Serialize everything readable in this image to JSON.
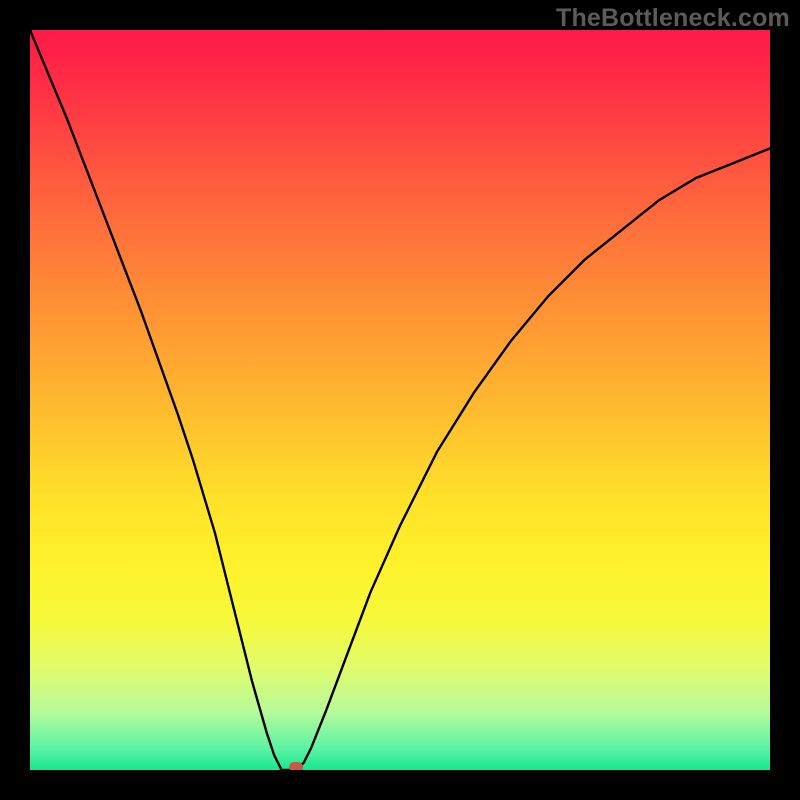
{
  "watermark": "TheBottleneck.com",
  "colors": {
    "page_bg": "#000000",
    "curve_stroke": "#000000",
    "marker_fill": "#c55a4a",
    "gradient_top": "#ff1a47",
    "gradient_bottom": "#18e78f"
  },
  "chart_data": {
    "type": "line",
    "title": "",
    "xlabel": "",
    "ylabel": "",
    "xlim": [
      0,
      100
    ],
    "ylim": [
      0,
      100
    ],
    "grid": false,
    "notes": "V-shaped bottleneck curve over rainbow gradient. Minimum at marker position.",
    "series": [
      {
        "name": "bottleneck-curve",
        "x": [
          0,
          5,
          10,
          15,
          20,
          22,
          25,
          28,
          30,
          32,
          33,
          34,
          35,
          36,
          37,
          38,
          40,
          43,
          46,
          50,
          55,
          60,
          65,
          70,
          75,
          80,
          85,
          90,
          95,
          100
        ],
        "values": [
          100,
          88,
          75,
          62,
          48,
          42,
          32,
          20,
          12,
          5,
          2,
          0,
          0,
          0,
          1,
          3,
          8,
          16,
          24,
          33,
          43,
          51,
          58,
          64,
          69,
          73,
          77,
          80,
          82,
          84
        ]
      }
    ],
    "marker": {
      "x": 36,
      "y": 0
    }
  }
}
